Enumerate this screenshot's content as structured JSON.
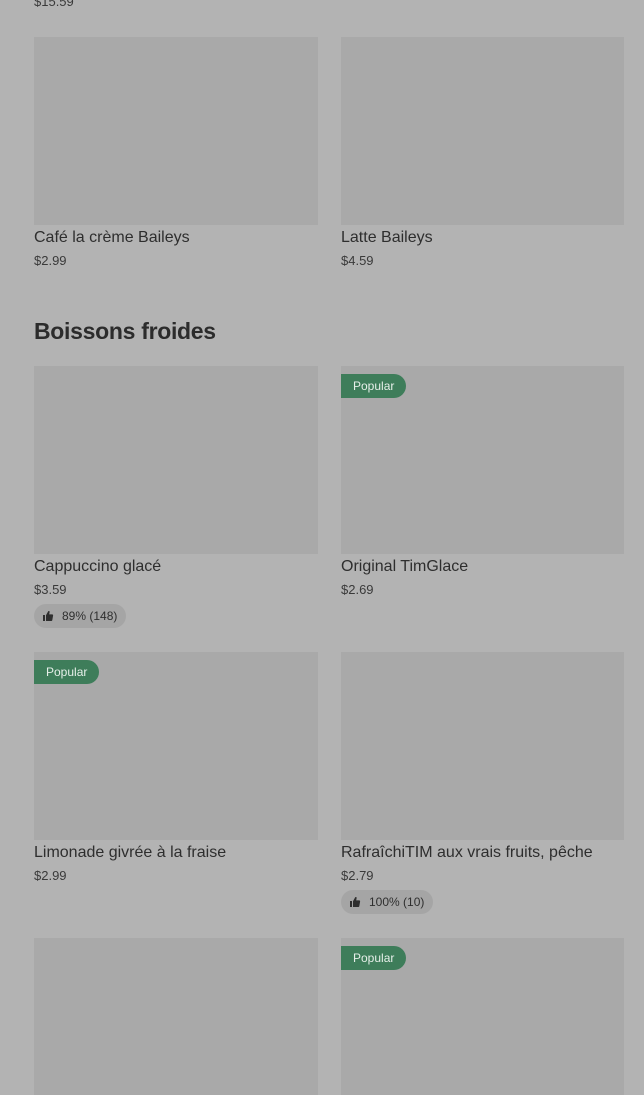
{
  "top_price": "$15.59",
  "sections": {
    "prev": {
      "items": [
        {
          "name": "Café la crème Baileys",
          "price": "$2.99"
        },
        {
          "name": "Latte Baileys",
          "price": "$4.59"
        }
      ]
    },
    "cold": {
      "title": "Boissons froides",
      "items": [
        {
          "name": "Cappuccino glacé",
          "price": "$3.59",
          "rating": "89% (148)"
        },
        {
          "name": "Original TimGlace",
          "price": "$2.69",
          "badge": "Popular"
        },
        {
          "name": "Limonade givrée à la fraise",
          "price": "$2.99",
          "badge": "Popular"
        },
        {
          "name": "RafraîchiTIM aux vrais fruits, pêche",
          "price": "$2.79",
          "rating": "100% (10)"
        },
        {
          "badge": "Popular"
        }
      ]
    }
  },
  "colors": {
    "background": "#b3b3b3",
    "image_placeholder": "#a9a9a9",
    "badge": "#3e7d5a",
    "rating_pill": "#a5a5a5"
  },
  "icons": {
    "rating": "thumbs-up-icon"
  }
}
